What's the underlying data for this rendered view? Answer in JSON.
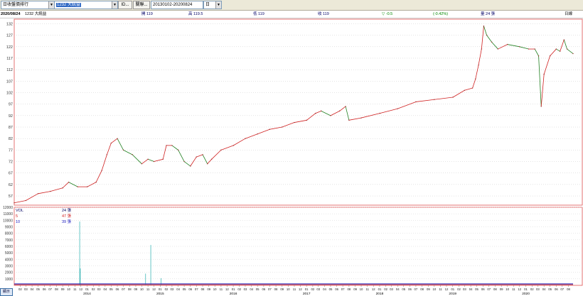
{
  "toolbar": {
    "category": "日收盤價排行",
    "stock": "1232 大統益",
    "id_button": "ID...",
    "related_button": "關聯...",
    "date_range": "20130102-20200824",
    "period": "日"
  },
  "infobar": {
    "date": "2020/08/24",
    "name": "1232 大統益",
    "open": "開 119",
    "high": "高 119.5",
    "low": "低 119",
    "close": "收 119",
    "change": "▽ -0.5",
    "pct": "(-0.42%)",
    "volume": "量 24 張",
    "period": "日線"
  },
  "chart_data": [
    {
      "type": "line",
      "title": "",
      "ylabel": "",
      "ylim": [
        53,
        134
      ],
      "yticks": [
        57,
        62,
        67,
        72,
        77,
        82,
        87,
        92,
        97,
        102,
        107,
        112,
        117,
        122,
        127,
        132
      ],
      "x_start": "2013-01-02",
      "x_end": "2020-08-24",
      "year_labels": [
        "2014",
        "2015",
        "2016",
        "2017",
        "2018",
        "2019",
        "2020"
      ],
      "month_labels": [
        "02",
        "03",
        "04",
        "05",
        "06",
        "07",
        "08",
        "09",
        "10",
        "11",
        "12",
        "01"
      ],
      "series": [
        {
          "x": [
            "2013-01-02",
            "2013-03-01",
            "2013-05-01",
            "2013-07-01",
            "2013-09-01",
            "2013-10-01",
            "2013-11-15",
            "2014-01-02",
            "2014-02-15",
            "2014-03-15",
            "2014-04-10",
            "2014-05-01",
            "2014-06-01",
            "2014-07-01",
            "2014-08-15",
            "2014-10-01",
            "2014-11-01",
            "2014-12-01",
            "2015-01-15",
            "2015-02-01",
            "2015-03-01",
            "2015-04-01",
            "2015-05-01",
            "2015-06-01",
            "2015-07-01",
            "2015-08-01",
            "2015-08-25",
            "2015-09-15",
            "2015-11-01",
            "2016-01-02",
            "2016-03-01",
            "2016-05-01",
            "2016-07-01",
            "2016-09-01",
            "2016-11-01",
            "2017-01-02",
            "2017-02-15",
            "2017-03-15",
            "2017-05-01",
            "2017-06-15",
            "2017-07-15",
            "2017-08-01",
            "2017-10-01",
            "2018-01-02",
            "2018-04-01",
            "2018-07-01",
            "2018-10-01",
            "2019-01-02",
            "2019-03-01",
            "2019-04-10",
            "2019-04-25",
            "2019-05-10",
            "2019-05-25",
            "2019-06-05",
            "2019-06-20",
            "2019-07-15",
            "2019-08-15",
            "2019-10-01",
            "2019-12-01",
            "2020-01-15",
            "2020-02-15",
            "2020-03-05",
            "2020-03-18",
            "2020-04-01",
            "2020-05-01",
            "2020-06-01",
            "2020-06-20",
            "2020-07-10",
            "2020-07-25",
            "2020-08-24"
          ],
          "y": [
            54,
            55,
            58,
            59,
            60.5,
            63,
            61,
            61,
            63,
            68,
            75,
            80,
            82,
            77,
            75,
            71,
            73,
            72,
            73,
            79,
            79,
            77,
            72,
            70,
            74,
            75,
            71,
            73,
            77,
            79,
            82,
            84,
            86,
            87,
            89,
            90,
            93,
            94,
            92,
            94,
            96,
            90,
            91,
            93,
            95,
            98,
            99,
            100,
            103,
            104,
            108,
            114,
            121,
            131,
            127,
            124,
            121,
            123,
            122,
            121,
            121,
            118,
            96,
            110,
            118,
            121,
            120,
            125,
            121,
            119
          ]
        }
      ]
    },
    {
      "type": "bar",
      "title": "VOL",
      "ylim": [
        0,
        12000
      ],
      "yticks": [
        1000,
        2000,
        3000,
        4000,
        5000,
        6000,
        7000,
        8000,
        9000,
        10000,
        11000,
        12000
      ],
      "legend": [
        {
          "name": "VOL",
          "value": "24 張"
        },
        {
          "name": "5",
          "value": "47 張"
        },
        {
          "name": "10",
          "value": "39 張"
        }
      ],
      "spikes": [
        {
          "x": "2013-11-25",
          "value": 9800
        },
        {
          "x": "2013-11-28",
          "value": 2600
        },
        {
          "x": "2014-10-20",
          "value": 1800
        },
        {
          "x": "2014-11-15",
          "value": 6200
        },
        {
          "x": "2015-01-05",
          "value": 1100
        }
      ]
    }
  ],
  "sidebar": {
    "button": "顯示"
  }
}
